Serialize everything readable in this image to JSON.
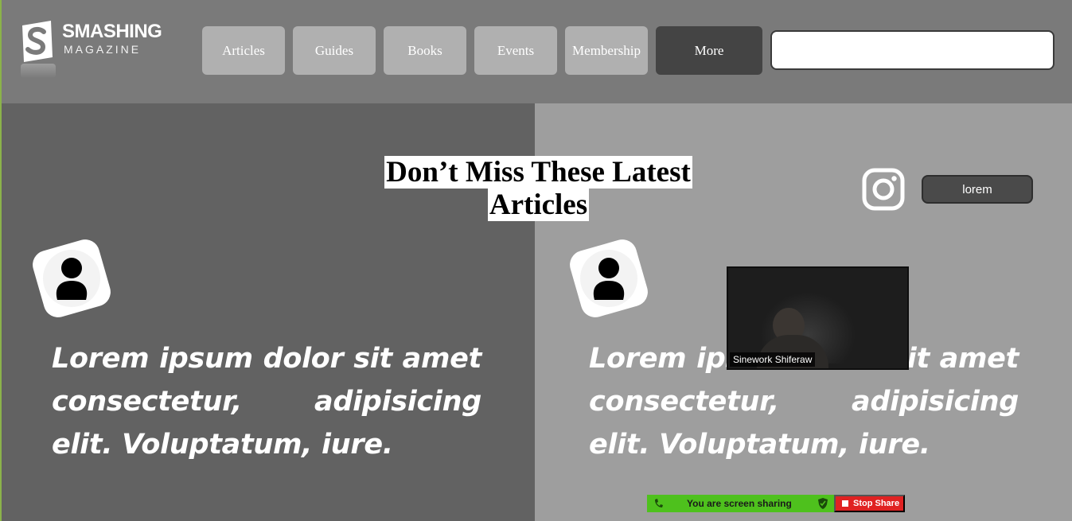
{
  "brand": {
    "title": "SMASHING",
    "subtitle": "MAGAZINE"
  },
  "nav": {
    "items": [
      "Articles",
      "Guides",
      "Books",
      "Events",
      "Membership"
    ],
    "more": "More"
  },
  "search": {
    "value": "",
    "placeholder": ""
  },
  "section": {
    "title": "Don’t Miss These Latest Articles"
  },
  "social": {
    "instagram_icon": "instagram-icon",
    "button_label": "lorem"
  },
  "cards": [
    {
      "text": "Lorem ipsum dolor sit amet consectetur, adipisicing elit. Voluptatum, iure.",
      "avatar_icon": "user-icon"
    },
    {
      "text": "Lorem ipsum dolor sit amet consectetur, adipisicing elit. Voluptatum, iure.",
      "avatar_icon": "user-icon"
    }
  ],
  "video": {
    "participant": "Sinework Shiferaw"
  },
  "share": {
    "status": "You are screen sharing",
    "stop_label": "Stop Share"
  },
  "colors": {
    "header_bg": "#7a7a7a",
    "left_panel": "#626262",
    "right_panel": "#9e9e9e",
    "nav_button": "#b0b0b0",
    "more_button": "#444444",
    "share_green": "#4ec11d",
    "stop_red": "#e02222"
  }
}
